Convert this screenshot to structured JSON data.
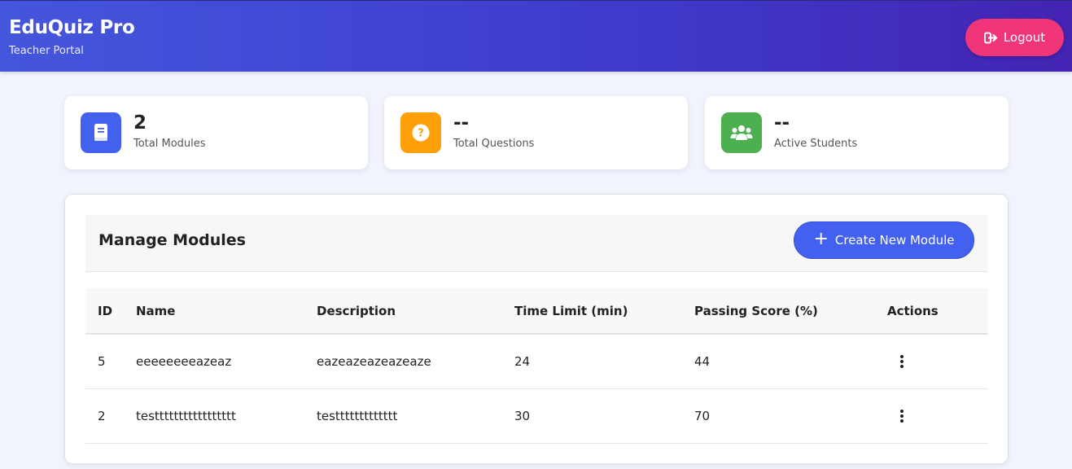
{
  "header": {
    "title": "EduQuiz Pro",
    "subtitle": "Teacher Portal",
    "logout_label": "Logout"
  },
  "stats": [
    {
      "value": "2",
      "label": "Total Modules",
      "icon": "book-icon",
      "color": "#4361ee"
    },
    {
      "value": "--",
      "label": "Total Questions",
      "icon": "question-icon",
      "color": "#ff9f0a"
    },
    {
      "value": "--",
      "label": "Active Students",
      "icon": "users-icon",
      "color": "#4caf50"
    }
  ],
  "panel": {
    "title": "Manage Modules",
    "create_label": "Create New Module"
  },
  "table": {
    "headers": [
      "ID",
      "Name",
      "Description",
      "Time Limit (min)",
      "Passing Score (%)",
      "Actions"
    ],
    "rows": [
      {
        "id": "5",
        "name": "eeeeeeeeazeaz",
        "description": "eazeazeazeazeaze",
        "time_limit": "24",
        "passing_score": "44"
      },
      {
        "id": "2",
        "name": "testtttttttttttttttt",
        "description": "testtttttttttttt",
        "time_limit": "30",
        "passing_score": "70"
      }
    ]
  },
  "colors": {
    "accent": "#4361ee",
    "logout": "#f0357a"
  }
}
